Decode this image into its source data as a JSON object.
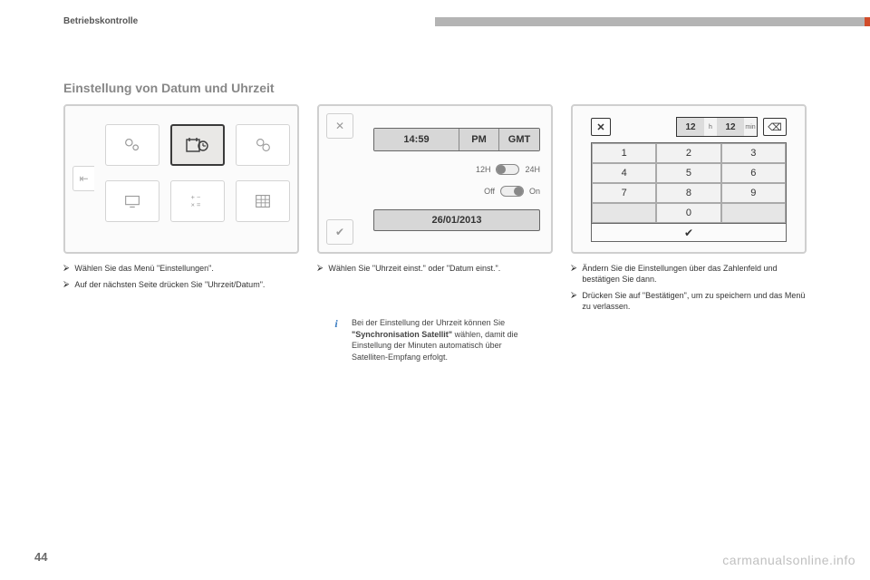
{
  "header": {
    "section": "Betriebskontrolle"
  },
  "title": "Einstellung von Datum und Uhrzeit",
  "screens": {
    "menu": {
      "icons": [
        "gears-icon",
        "clock-calendar-icon",
        "wheels-icon",
        "monitor-icon",
        "calculator-icon",
        "table-icon"
      ],
      "selected_index": 1
    },
    "datetime": {
      "time": "14:59",
      "ampm": "PM",
      "tz": "GMT",
      "format_left": "12H",
      "format_right": "24H",
      "sync_off": "Off",
      "sync_on": "On",
      "date": "26/01/2013"
    },
    "keypad": {
      "hour": "12",
      "hour_unit": "h",
      "min": "12",
      "min_unit": "min",
      "keys": [
        "1",
        "2",
        "3",
        "4",
        "5",
        "6",
        "7",
        "8",
        "9",
        "",
        "0",
        ""
      ]
    }
  },
  "bullets": {
    "col1": [
      "Wählen Sie das Menü \"Einstellungen\".",
      "Auf der nächsten Seite drücken Sie \"Uhrzeit/Datum\"."
    ],
    "col2": [
      "Wählen Sie \"Uhrzeit einst.\" oder \"Datum einst.\"."
    ],
    "col3": [
      "Ändern Sie die Einstellungen über das Zahlenfeld und bestätigen Sie dann.",
      "Drücken Sie auf \"Bestätigen\", um zu speichern und das Menü zu verlassen."
    ]
  },
  "info": {
    "pre": "Bei der Einstellung der Uhrzeit können Sie ",
    "bold": "\"Synchronisation Satellit\"",
    "post": " wählen, damit die Einstellung der Minuten automatisch über Satelliten-Empfang erfolgt."
  },
  "page_number": "44",
  "watermark": "carmanualsonline.info"
}
